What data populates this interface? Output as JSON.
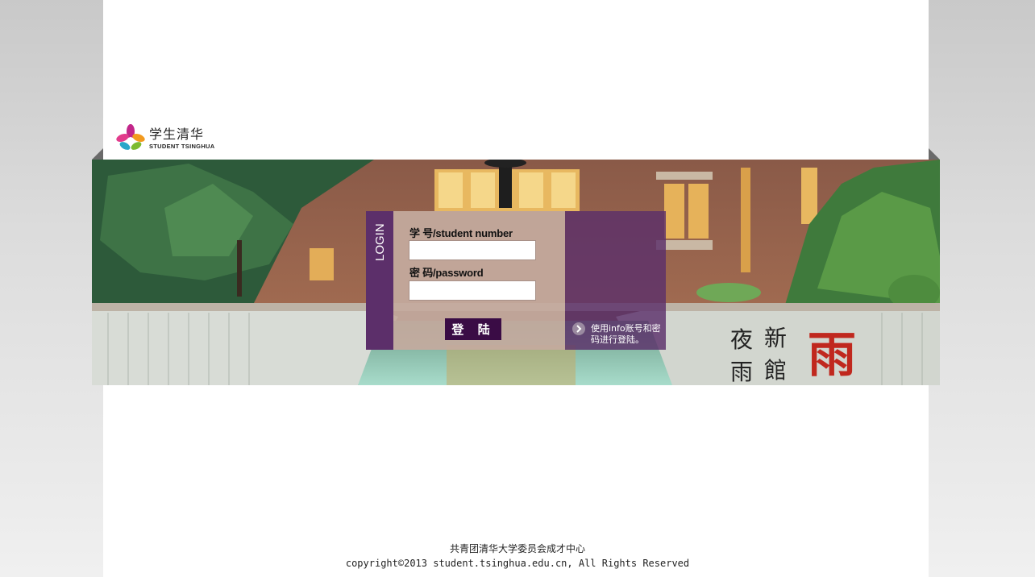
{
  "logo": {
    "name_cn": "学生清华",
    "name_en": "STUDENT TSINGHUA"
  },
  "login": {
    "tab_label": "LOGIN",
    "student_number_label": "学 号/student number",
    "password_label": "密 码/password",
    "student_number_value": "",
    "password_value": "",
    "submit_label": "登 陆",
    "hint_text": "使用info账号和密码进行登陆。"
  },
  "banner": {
    "calligraphy_col1_top": "新",
    "calligraphy_col1_bottom": "館",
    "calligraphy_col2_top": "夜",
    "calligraphy_col2_bottom": "雨",
    "calligraphy_large": "雨"
  },
  "footer": {
    "org": "共青团清华大学委员会成才中心",
    "copyright": "copyright©2013 student.tsinghua.edu.cn, All Rights Reserved"
  },
  "colors": {
    "accent_purple": "#3a0c45",
    "panel_purple": "#5c2f6a",
    "calligraphy_red": "#c0281e"
  }
}
